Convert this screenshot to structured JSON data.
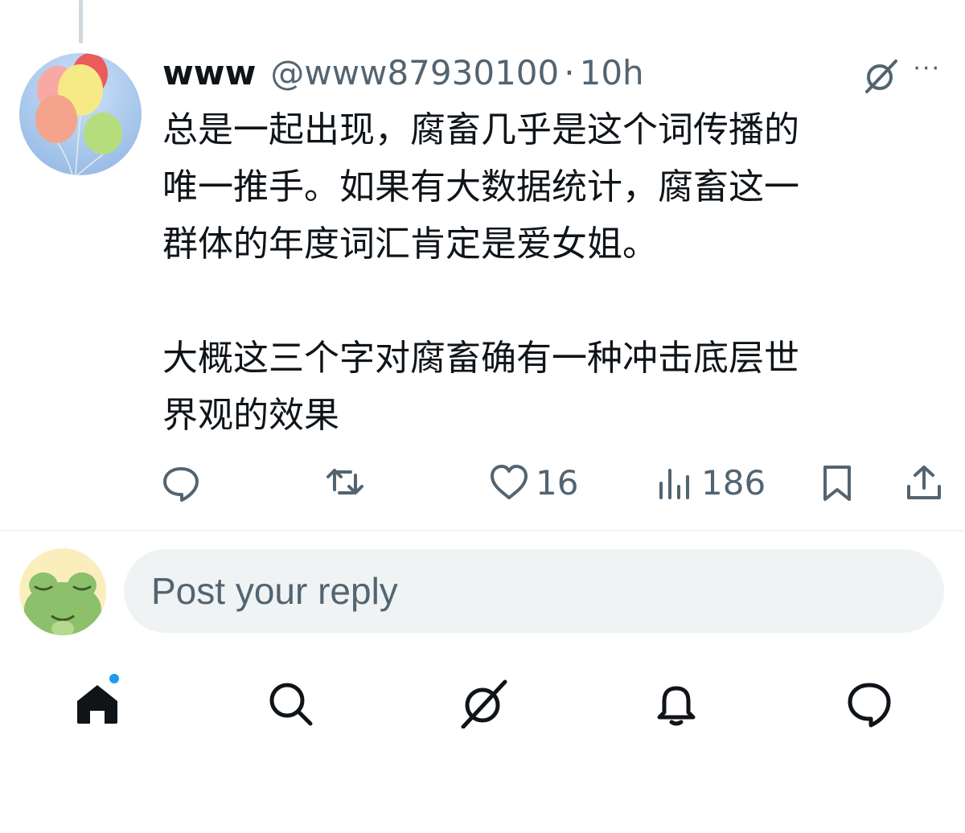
{
  "tweet": {
    "display_name": "www",
    "handle": "@www87930100",
    "separator": "·",
    "time": "10h",
    "more": "···",
    "text_lines": [
      "总是一起出现，腐畜几乎是这个词传播的",
      "唯一推手。如果有大数据统计，腐畜这一",
      "群体的年度词汇肯定是爱女姐。",
      "大概这三个字对腐畜确有一种冲击底层世",
      "界观的效果"
    ],
    "actions": {
      "likes": "16",
      "views": "186"
    }
  },
  "reply": {
    "placeholder": "Post your reply"
  },
  "icons": {
    "avatar": "balloons-avatar",
    "grok": "grok-icon",
    "reply": "reply-icon",
    "retweet": "retweet-icon",
    "like": "heart-icon",
    "views": "views-icon",
    "bookmark": "bookmark-icon",
    "share": "share-icon",
    "nav": [
      "home-icon",
      "search-icon",
      "grok-icon",
      "bell-icon",
      "messages-icon"
    ]
  },
  "colors": {
    "text": "#0f1419",
    "secondary": "#536471",
    "accent": "#1d9bf0",
    "reply_bg": "#eff3f4"
  }
}
